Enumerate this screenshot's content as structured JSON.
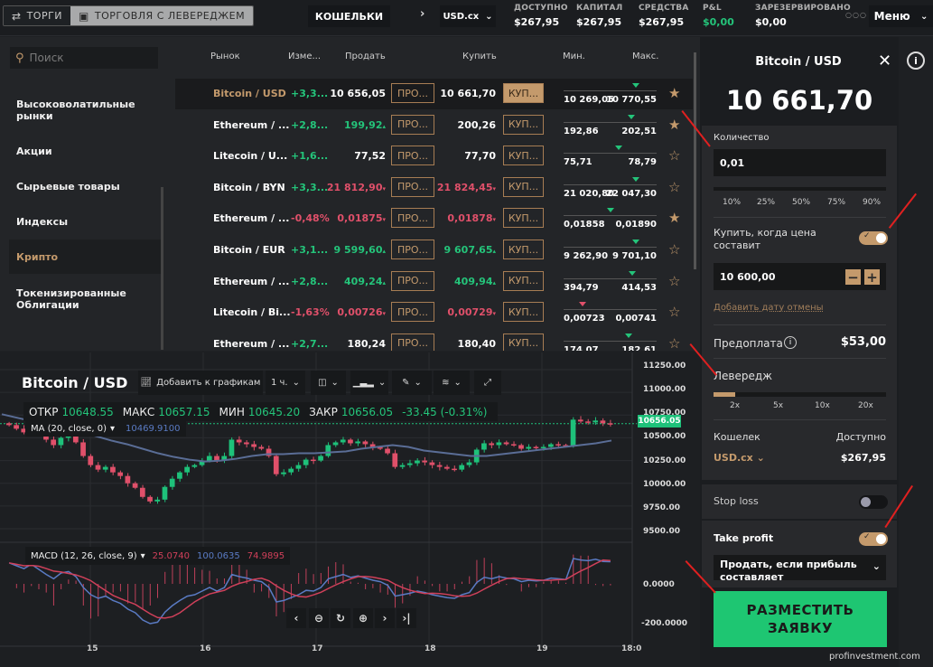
{
  "topbar": {
    "tabs": [
      {
        "label": "ТОРГИ",
        "icon": "swap-icon",
        "active": false
      },
      {
        "label": "ТОРГОВЛЯ С ЛЕВЕРЕДЖЕМ",
        "icon": "cast-icon",
        "active": true
      }
    ],
    "wallets_label": "КОШЕЛЬКИ",
    "currency": "USD.cx",
    "stats": [
      {
        "label": "ДОСТУПНО",
        "value": "$267,95"
      },
      {
        "label": "КАПИТАЛ",
        "value": "$267,95"
      },
      {
        "label": "СРЕДСТВА",
        "value": "$267,95"
      },
      {
        "label": "P&L",
        "value": "$0,00"
      },
      {
        "label": "ЗАРЕЗЕРВИРОВАНО",
        "value": "$0,00"
      }
    ],
    "menu_label": "Меню"
  },
  "sidebar": {
    "search_placeholder": "Поиск",
    "categories": [
      {
        "label": "Высоковолатильные рынки",
        "active": false
      },
      {
        "label": "Акции",
        "active": false
      },
      {
        "label": "Сырьевые товары",
        "active": false
      },
      {
        "label": "Индексы",
        "active": false
      },
      {
        "label": "Крипто",
        "active": true
      },
      {
        "label": "Токенизированные Облигации",
        "active": false
      }
    ]
  },
  "market": {
    "columns": [
      "Рынок",
      "Изме...",
      "Продать",
      "Купить",
      "Мин.",
      "Макс."
    ],
    "sell_btn": "ПРО...",
    "buy_btn": "КУП...",
    "rows": [
      {
        "name": "Bitcoin / USD",
        "change": "+3,3...",
        "sell": "10 656,05",
        "buy": "10 661,70",
        "min": "10 269,05",
        "max": "10 770,55",
        "fav": true,
        "selected": true,
        "dir": "none",
        "range_pos": 0.8
      },
      {
        "name": "Ethereum / ...",
        "change": "+2,8...",
        "sell": "199,92",
        "buy": "200,26",
        "min": "192,86",
        "max": "202,51",
        "fav": true,
        "selected": false,
        "dir": "up-sell",
        "range_pos": 0.75
      },
      {
        "name": "Litecoin / U...",
        "change": "+1,6...",
        "sell": "77,52",
        "buy": "77,70",
        "min": "75,71",
        "max": "78,79",
        "fav": false,
        "selected": false,
        "dir": "none",
        "range_pos": 0.6
      },
      {
        "name": "Bitcoin / BYN",
        "change": "+3,3...",
        "sell": "21 812,90",
        "buy": "21 824,45",
        "min": "21 020,80",
        "max": "22 047,30",
        "fav": false,
        "selected": false,
        "dir": "down",
        "range_pos": 0.8
      },
      {
        "name": "Ethereum / ...",
        "change": "-0,48%",
        "sell": "0,01875",
        "buy": "0,01878",
        "min": "0,01858",
        "max": "0,01890",
        "fav": true,
        "selected": false,
        "dir": "down",
        "range_pos": 0.5
      },
      {
        "name": "Bitcoin / EUR",
        "change": "+3,1...",
        "sell": "9 599,60",
        "buy": "9 607,65",
        "min": "9 262,90",
        "max": "9 701,10",
        "fav": false,
        "selected": false,
        "dir": "up",
        "range_pos": 0.8
      },
      {
        "name": "Ethereum / ...",
        "change": "+2,8...",
        "sell": "409,24",
        "buy": "409,94",
        "min": "394,79",
        "max": "414,53",
        "fav": false,
        "selected": false,
        "dir": "up",
        "range_pos": 0.76
      },
      {
        "name": "Litecoin / Bi...",
        "change": "-1,63%",
        "sell": "0,00726",
        "buy": "0,00729",
        "min": "0,00723",
        "max": "0,00741",
        "fav": false,
        "selected": false,
        "dir": "down",
        "range_pos": 0.18
      },
      {
        "name": "Ethereum / ...",
        "change": "+2,7...",
        "sell": "180,24",
        "buy": "180,40",
        "min": "174,07",
        "max": "182,61",
        "fav": false,
        "selected": false,
        "dir": "none",
        "range_pos": 0.72
      }
    ]
  },
  "chart": {
    "title": "Bitcoin / USD",
    "toolbar": {
      "add_label": "Добавить к графикам",
      "interval": "1 ч."
    },
    "ohlc": [
      {
        "k": "ОТКР",
        "v": "10648.55"
      },
      {
        "k": "МАКС",
        "v": "10657.15"
      },
      {
        "k": "МИН",
        "v": "10645.20"
      },
      {
        "k": "ЗАКР",
        "v": "10656.05"
      }
    ],
    "change": "-33.45 (-0.31%)",
    "ma_label": "MA (20, close, 0)",
    "ma_value": "10469.9100",
    "macd_label": "MACD (12, 26, close, 9)",
    "macd_values": [
      "25.0740",
      "100.0635",
      "74.9895"
    ],
    "price_tag": "10656.05"
  },
  "chart_data": {
    "type": "candlestick",
    "title": "Bitcoin / USD",
    "x_ticks": [
      "15",
      "16",
      "17",
      "18",
      "19",
      "18:0"
    ],
    "y_ticks": [
      "11250.00",
      "11000.00",
      "10750.00",
      "10500.00",
      "10250.00",
      "10000.00",
      "9750.00",
      "9500.00"
    ],
    "ylim": [
      9450,
      11300
    ],
    "macd_ticks": [
      "0.0000",
      "-200.0000"
    ],
    "last_price": 10656.05,
    "close_series": [
      10640,
      10600,
      10560,
      10620,
      10550,
      10480,
      10420,
      10500,
      10520,
      10450,
      10300,
      10200,
      10150,
      10180,
      10120,
      10080,
      10000,
      9950,
      9850,
      9800,
      9820,
      9960,
      10050,
      10120,
      10180,
      10200,
      10250,
      10300,
      10250,
      10300,
      10480,
      10450,
      10430,
      10400,
      10380,
      10300,
      10100,
      10120,
      10160,
      10200,
      10260,
      10250,
      10300,
      10420,
      10450,
      10480,
      10440,
      10460,
      10430,
      10400,
      10380,
      10330,
      10180,
      10200,
      10220,
      10250,
      10230,
      10200,
      10180,
      10160,
      10150,
      10200,
      10230,
      10370,
      10440,
      10420,
      10450,
      10430,
      10420,
      10380,
      10400,
      10390,
      10400,
      10430,
      10420,
      10410,
      10700,
      10680,
      10670,
      10690,
      10660,
      10656
    ],
    "ma_series": [
      10760,
      10720,
      10680,
      10640,
      10600,
      10560,
      10520,
      10470,
      10430,
      10380,
      10330,
      10290,
      10260,
      10240,
      10250,
      10270,
      10300,
      10320,
      10320,
      10330,
      10330,
      10340,
      10350,
      10380,
      10400,
      10420,
      10400,
      10360,
      10340,
      10320,
      10300,
      10300,
      10320,
      10340,
      10360,
      10380,
      10400,
      10420,
      10440,
      10470
    ]
  },
  "panel": {
    "title": "Bitcoin / USD",
    "price": "10 661,70",
    "qty_label": "Количество",
    "qty_value": "0,01",
    "pct_options": [
      "10%",
      "25%",
      "50%",
      "75%",
      "90%"
    ],
    "limit_label": "Купить, когда цена составит",
    "limit_on": true,
    "limit_value": "10 600,00",
    "cancel_date_link": "Добавить дату отмены",
    "prepay_label": "Предоплата",
    "prepay_value": "$53,00",
    "leverage_label": "Левередж",
    "leverage_options": [
      "2x",
      "5x",
      "10x",
      "20x"
    ],
    "leverage_selected": "2x",
    "wallet_label": "Кошелек",
    "wallet_value": "USD.cx",
    "available_label": "Доступно",
    "available_value": "$267,95",
    "stoploss_label": "Stop loss",
    "stoploss_on": false,
    "takeprofit_label": "Take profit",
    "takeprofit_on": true,
    "tp_select": "Продать, если прибыль составляет",
    "place_label": "РАЗМЕСТИТЬ ЗАЯВКУ"
  },
  "watermark": "profinvestment.com",
  "colors": {
    "accent": "#c49a6c",
    "green": "#24c47a",
    "red": "#e0506a",
    "cta": "#1ec672"
  }
}
